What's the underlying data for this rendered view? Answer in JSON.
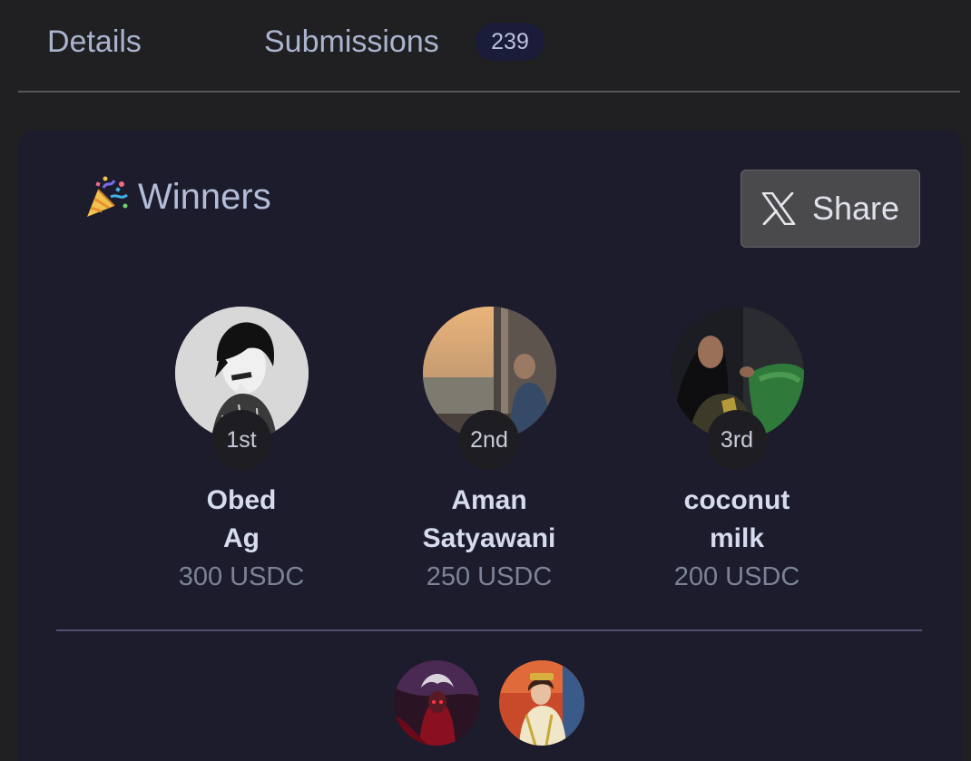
{
  "tabs": {
    "details_label": "Details",
    "submissions_label": "Submissions",
    "submissions_count": "239"
  },
  "winners": {
    "title": "Winners",
    "share_label": "Share",
    "list": [
      {
        "rank": "1st",
        "name_line1": "Obed",
        "name_line2": "Ag",
        "prize": "300 USDC"
      },
      {
        "rank": "2nd",
        "name_line1": "Aman",
        "name_line2": "Satyawani",
        "prize": "250 USDC"
      },
      {
        "rank": "3rd",
        "name_line1": "coconut",
        "name_line2": "milk",
        "prize": "200 USDC"
      }
    ]
  },
  "icons": {
    "title_icon": "party-popper-icon",
    "share_icon": "x-logo-icon"
  },
  "colors": {
    "page_background": "#202022",
    "card_background": "#1c1c2c",
    "badge_background": "#1b1b3a",
    "share_button": "#4a4a4d"
  }
}
